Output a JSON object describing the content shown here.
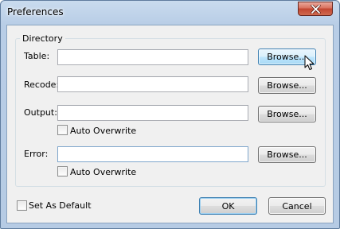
{
  "window": {
    "title": "Preferences"
  },
  "directory": {
    "group_title": "Directory",
    "table": {
      "label": "Table:",
      "value": "",
      "browse_label": "Browse..."
    },
    "recode": {
      "label": "Recode:",
      "value": "",
      "browse_label": "Browse..."
    },
    "output": {
      "label": "Output:",
      "value": "",
      "browse_label": "Browse...",
      "auto_overwrite_label": "Auto Overwrite",
      "auto_overwrite_checked": false
    },
    "error": {
      "label": "Error:",
      "value": "",
      "browse_label": "Browse...",
      "auto_overwrite_label": "Auto Overwrite",
      "auto_overwrite_checked": false
    }
  },
  "footer": {
    "set_as_default_label": "Set As Default",
    "set_as_default_checked": false,
    "ok_label": "OK",
    "cancel_label": "Cancel"
  },
  "icons": {
    "close": "close-icon",
    "cursor": "mouse-pointer-icon"
  },
  "colors": {
    "title_bar": "#b9cee7",
    "close_button": "#c94a35",
    "dialog_background": "#f0f0f0",
    "focus_border": "#3c7fb1"
  }
}
